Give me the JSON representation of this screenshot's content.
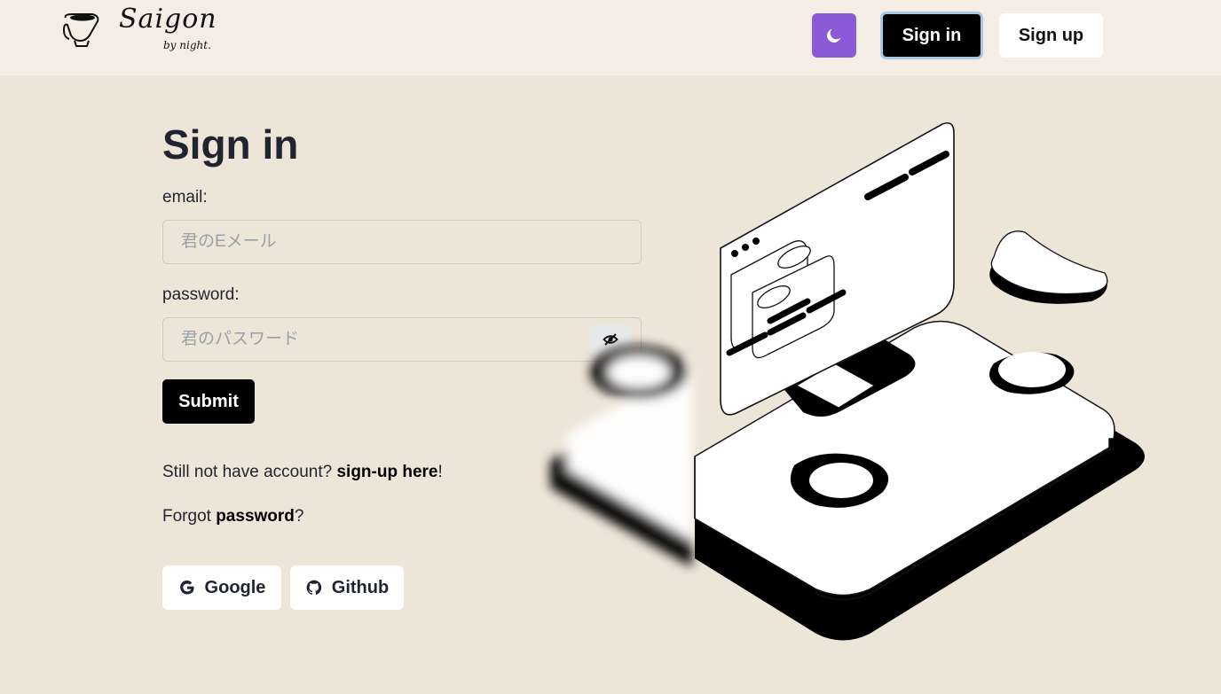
{
  "header": {
    "logo_text": "Saigon",
    "logo_sub": "by night.",
    "signin_label": "Sign in",
    "signup_label": "Sign up"
  },
  "icons": {
    "logo": "coffee-cup-icon",
    "theme": "moon-icon",
    "password_toggle": "eye-off-icon",
    "google": "google-icon",
    "github": "github-icon"
  },
  "colors": {
    "header_bg": "#F4EDE3",
    "page_bg": "#EEE5D9",
    "theme_button": "#8a5ad8",
    "primary_button": "#000000"
  },
  "form": {
    "title": "Sign in",
    "email_label": "email:",
    "email_placeholder": "君のEメール",
    "password_label": "password:",
    "password_placeholder": "君のパスワード",
    "submit_label": "Submit",
    "signup_prompt_prefix": "Still not have account? ",
    "signup_link": "sign-up here",
    "signup_prompt_suffix": "!",
    "forgot_prefix": "Forgot ",
    "forgot_link": "password",
    "forgot_suffix": "?",
    "google_label": "Google",
    "github_label": "Github"
  }
}
